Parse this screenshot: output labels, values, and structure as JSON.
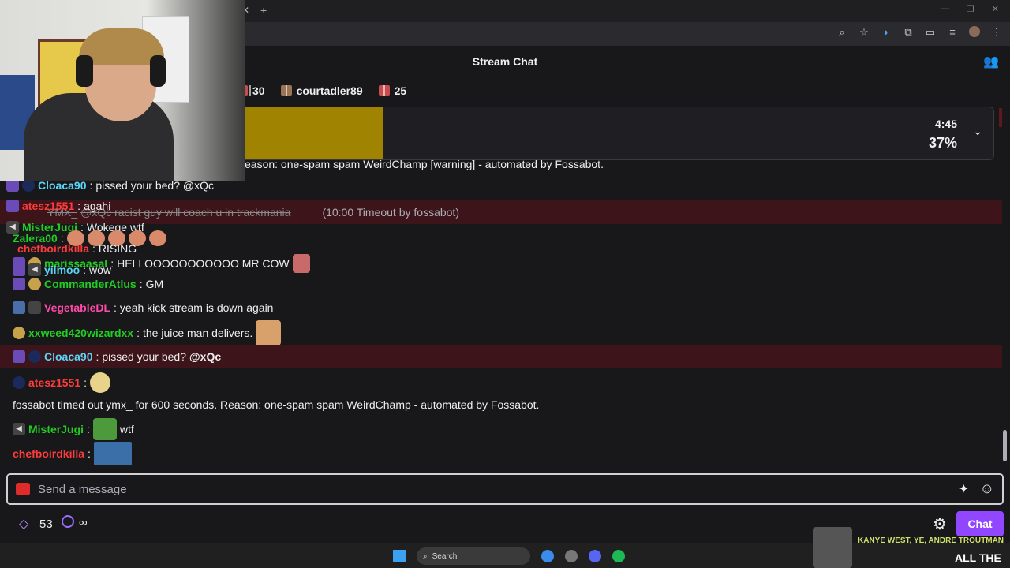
{
  "header": {
    "title": "Stream Chat"
  },
  "leaderboard": [
    {
      "label": "30"
    },
    {
      "label": "courtadler89"
    },
    {
      "label": "25"
    }
  ],
  "banner": {
    "time": "4:45",
    "percent": "37%",
    "fill_fraction": 0.19
  },
  "chat": {
    "pinned_top": "eason: one-spam spam WeirdChamp [warning] - automated by Fossabot.",
    "deleted": {
      "user": "YMX_",
      "text": "@xQc racist guy will coach u in trackmania",
      "note": "(10:00 Timeout by fossabot)"
    },
    "overlap": [
      {
        "user": "Cloaca90",
        "text": "pissed your bed? @xQc",
        "color": "#5bd5f5"
      },
      {
        "user": "atesz1551",
        "text": "agahi",
        "color": "#ff3b3b"
      },
      {
        "user": "MisterJugi",
        "text": "Wokege wtf",
        "color": "#22cc22"
      },
      {
        "user": "Zalera00",
        "text": "",
        "color": "#22cc22"
      },
      {
        "user": "chefboirdkilla",
        "text": "RISING",
        "color": "#ff3b3b"
      },
      {
        "user": "marissaasal",
        "text": "HELLOOOOOOOOOOO MR COW",
        "color": "#22cc22"
      },
      {
        "user": "yilmoo",
        "text": "wow",
        "color": "#5bd5f5"
      }
    ],
    "messages": [
      {
        "user": "CommanderAtlus",
        "text": "GM",
        "color": "#22cc22"
      },
      {
        "user": "VegetableDL",
        "text": "yeah kick stream is down again",
        "color": "#ff4aa8"
      },
      {
        "user": "xxweed420wizardxx",
        "text": "the juice man delivers.",
        "color": "#22cc22"
      },
      {
        "user": "Cloaca90",
        "text": "pissed your bed?",
        "mention": "@xQc",
        "color": "#5bd5f5"
      },
      {
        "user": "atesz1551",
        "text": "",
        "color": "#ff3b3b"
      },
      {
        "system": "fossabot timed out ymx_ for 600 seconds. Reason: one-spam spam WeirdChamp - automated by Fossabot."
      },
      {
        "user": "MisterJugi",
        "text": "wtf",
        "color": "#22cc22"
      },
      {
        "user": "chefboirdkilla",
        "text": "",
        "color": "#ff3b3b"
      }
    ]
  },
  "input": {
    "placeholder": "Send a message"
  },
  "footer": {
    "points": "53",
    "infinity": "∞",
    "chat_button": "Chat"
  },
  "taskbar": {
    "search_label": "Search",
    "now_playing_title": "KANYE WEST, YE, ANDRE TROUTMAN",
    "now_playing_sub": "ALL THE"
  },
  "colors": {
    "accent": "#9147ff",
    "highlight_row": "#3c1419",
    "banner_fill": "#a08300"
  }
}
